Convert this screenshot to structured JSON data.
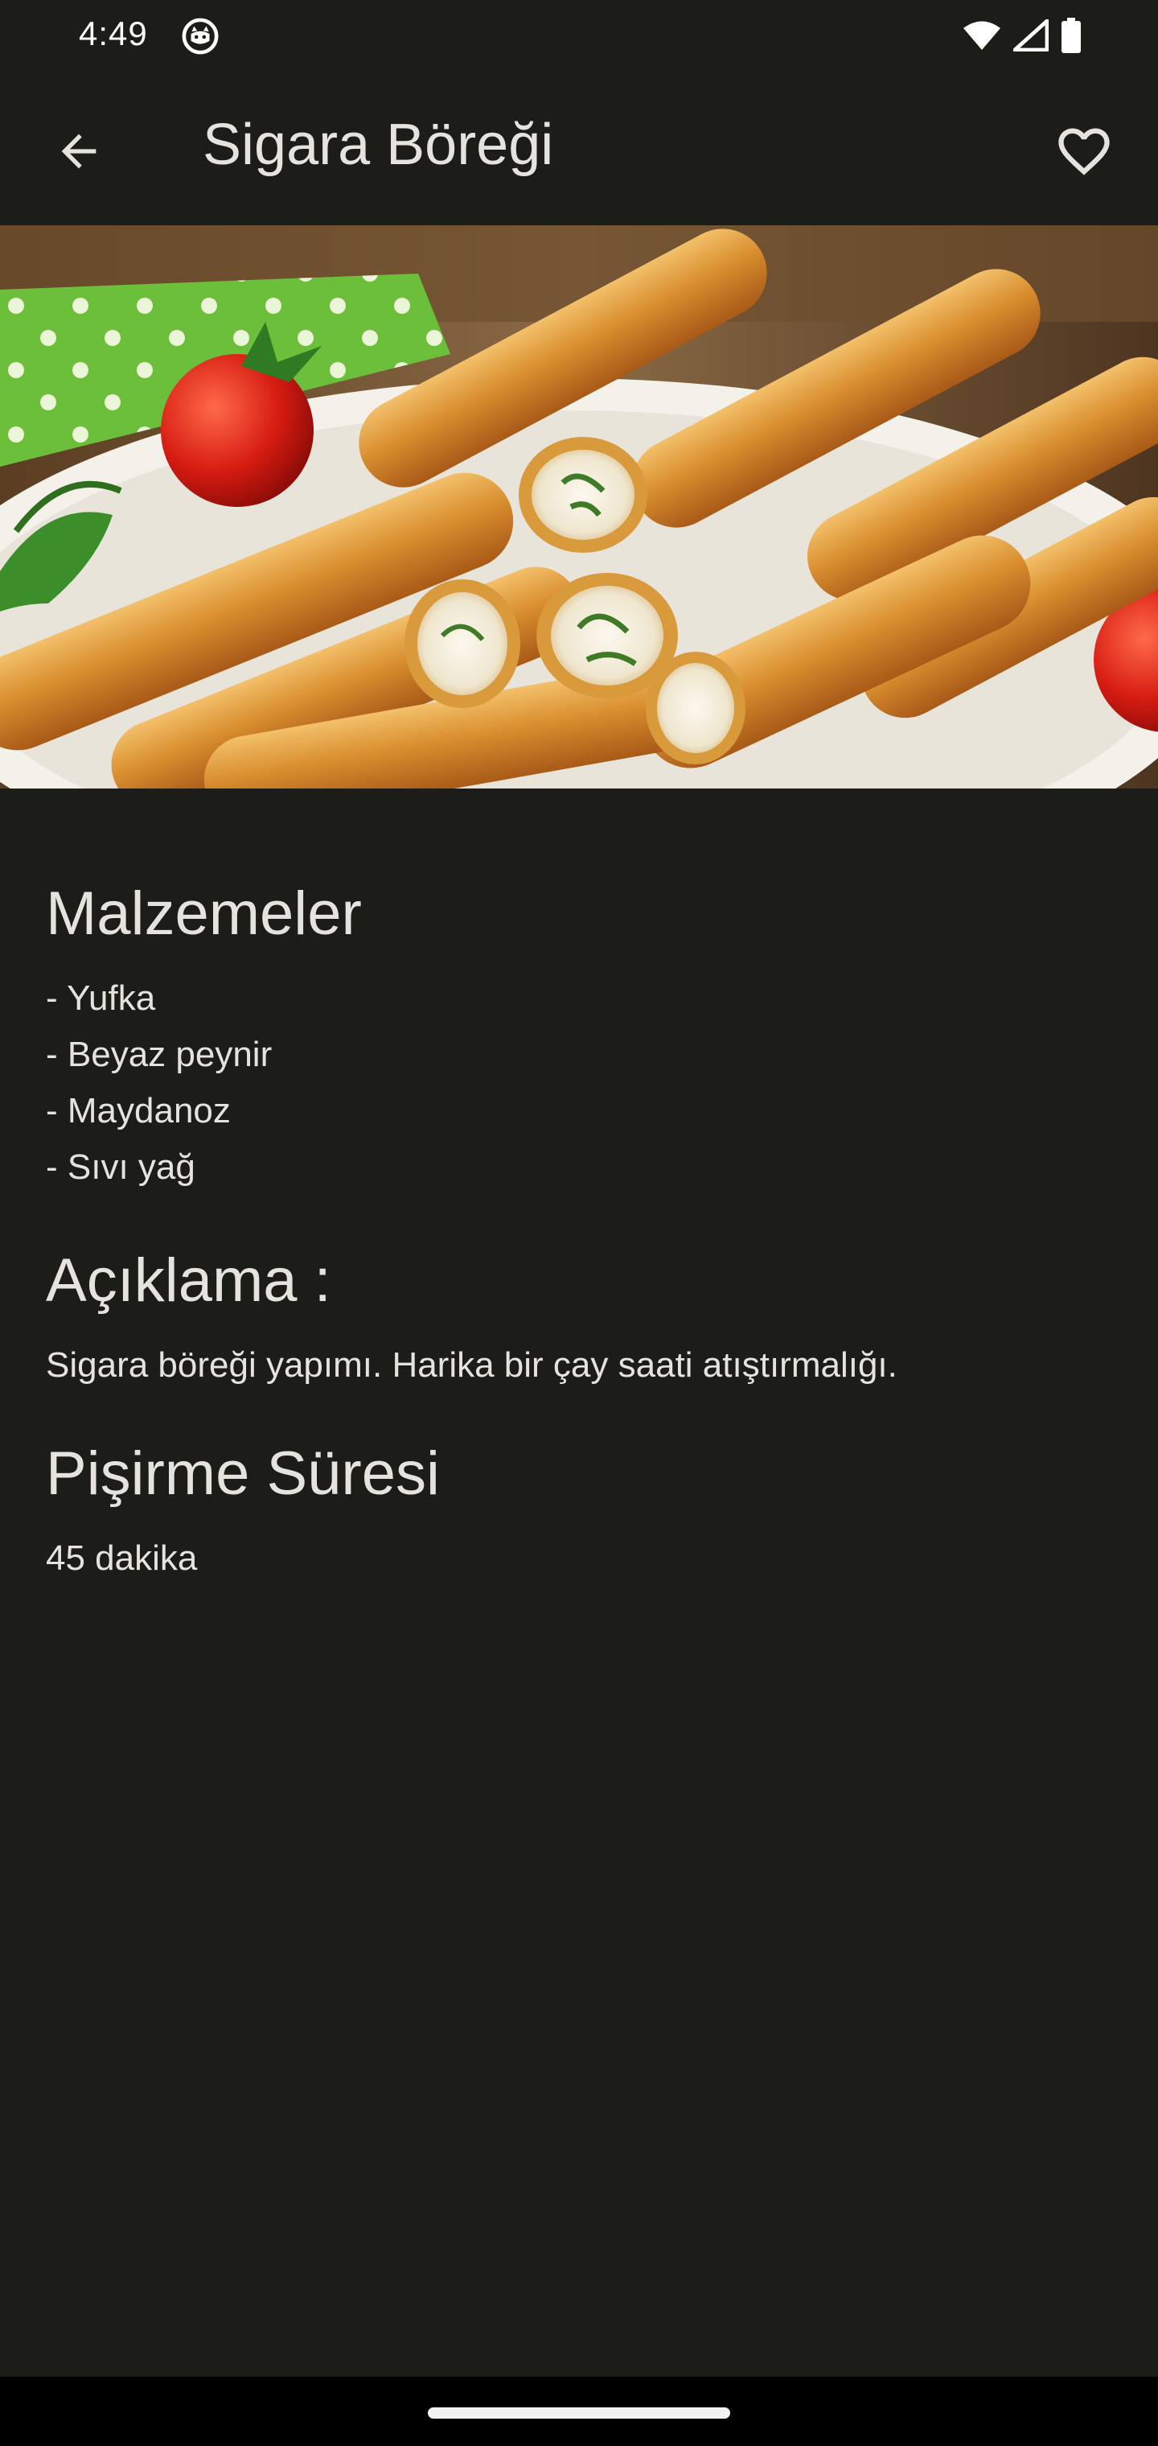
{
  "status_bar": {
    "time": "4:49"
  },
  "app_bar": {
    "title": "Sigara Böreği",
    "back_icon": "arrow-back-icon",
    "favorite_icon": "heart-outline-icon"
  },
  "hero": {
    "image_subject": "Sigara böreği rolls with tomatoes and parsley on a plate"
  },
  "ingredients": {
    "heading": "Malzemeler",
    "items": [
      "- Yufka",
      "- Beyaz peynir",
      "- Maydanoz",
      "- Sıvı yağ"
    ]
  },
  "description": {
    "heading": "Açıklama :",
    "text": "Sigara böreği yapımı. Harika bir çay saati atıştırmalığı."
  },
  "cooking_time": {
    "heading": "Pişirme Süresi",
    "value": "45 dakika"
  },
  "colors": {
    "background": "#1c1c19",
    "text": "#e6e3dc",
    "nav_bar": "#000000"
  }
}
